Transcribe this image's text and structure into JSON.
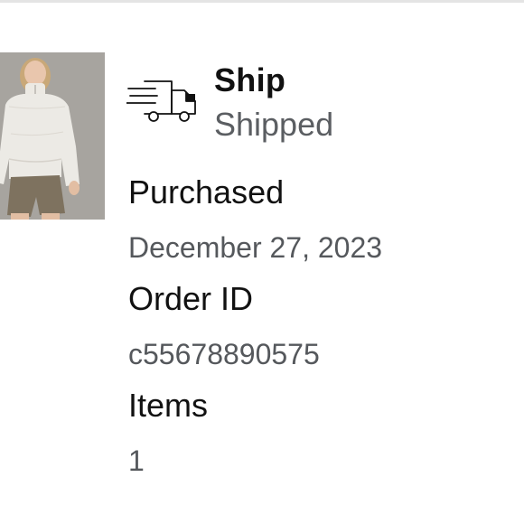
{
  "order": {
    "delivery_method": "Ship",
    "status": "Shipped",
    "purchased_label": "Purchased",
    "purchased_date": "December 27, 2023",
    "order_id_label": "Order ID",
    "order_id": "c55678890575",
    "items_label": "Items",
    "items_count": "1"
  },
  "icons": {
    "product": "product-thumbnail",
    "shipping": "delivery-truck-icon"
  },
  "colors": {
    "primary_text": "#111111",
    "secondary_text": "#55585c",
    "divider": "#e4e4e4",
    "background": "#ffffff"
  }
}
